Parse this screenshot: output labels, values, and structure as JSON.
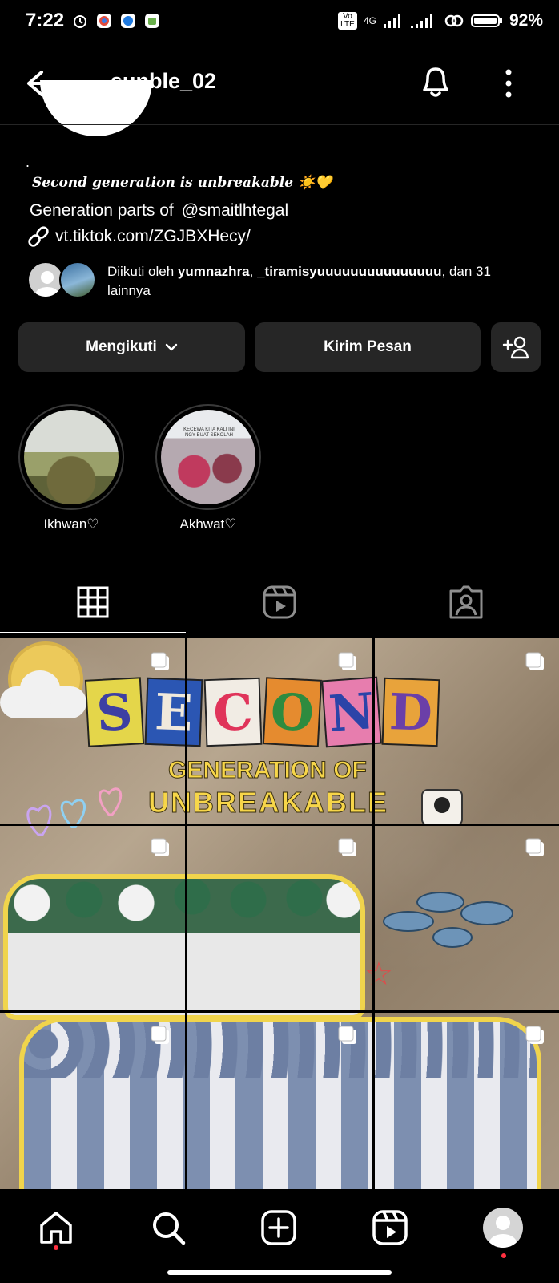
{
  "status_bar": {
    "time": "7:22",
    "network": "4G",
    "volte": "Vo LTE",
    "battery": "92%"
  },
  "header": {
    "username": "sunble_02"
  },
  "bio": {
    "dot": ".",
    "line1": "Second generation is unbreakable ☀️💛",
    "line2_prefix": "Generation parts of",
    "line2_mention": "@smaitlhtegal",
    "link": "vt.tiktok.com/ZGJBXHecy/"
  },
  "followed_by": {
    "prefix": "Diikuti oleh",
    "user1": "yumnazhra",
    "user2": "_tiramisyuuuuuuuuuuuuuuu",
    "suffix": ", dan 31 lainnya"
  },
  "buttons": {
    "following": "Mengikuti",
    "message": "Kirim Pesan"
  },
  "highlights": [
    {
      "label": "Ikhwan♡"
    },
    {
      "label": "Akhwat♡",
      "banner": "KECEWA KITA KALI INI NGY BUAT SEKOLAH"
    }
  ],
  "tabs": [
    "grid-icon",
    "reels-icon",
    "tagged-icon"
  ],
  "post_artwork": {
    "letters": [
      "S",
      "E",
      "C",
      "O",
      "N",
      "D"
    ],
    "letter_colors": [
      "#e4d64a",
      "#2b56b3",
      "#f1ece4",
      "#e58b2f",
      "#e77dae",
      "#e8a33b"
    ],
    "letter_text_colors": [
      "#3d3fa3",
      "#f0e9dc",
      "#e0345a",
      "#2e8b3f",
      "#2b44a8",
      "#6b3fa8"
    ],
    "gen_of": "GENERATION OF",
    "unbreakable": "UNBREAKABLE"
  },
  "bottom_nav": [
    "home-icon",
    "search-icon",
    "create-icon",
    "reels-icon",
    "profile-avatar"
  ]
}
